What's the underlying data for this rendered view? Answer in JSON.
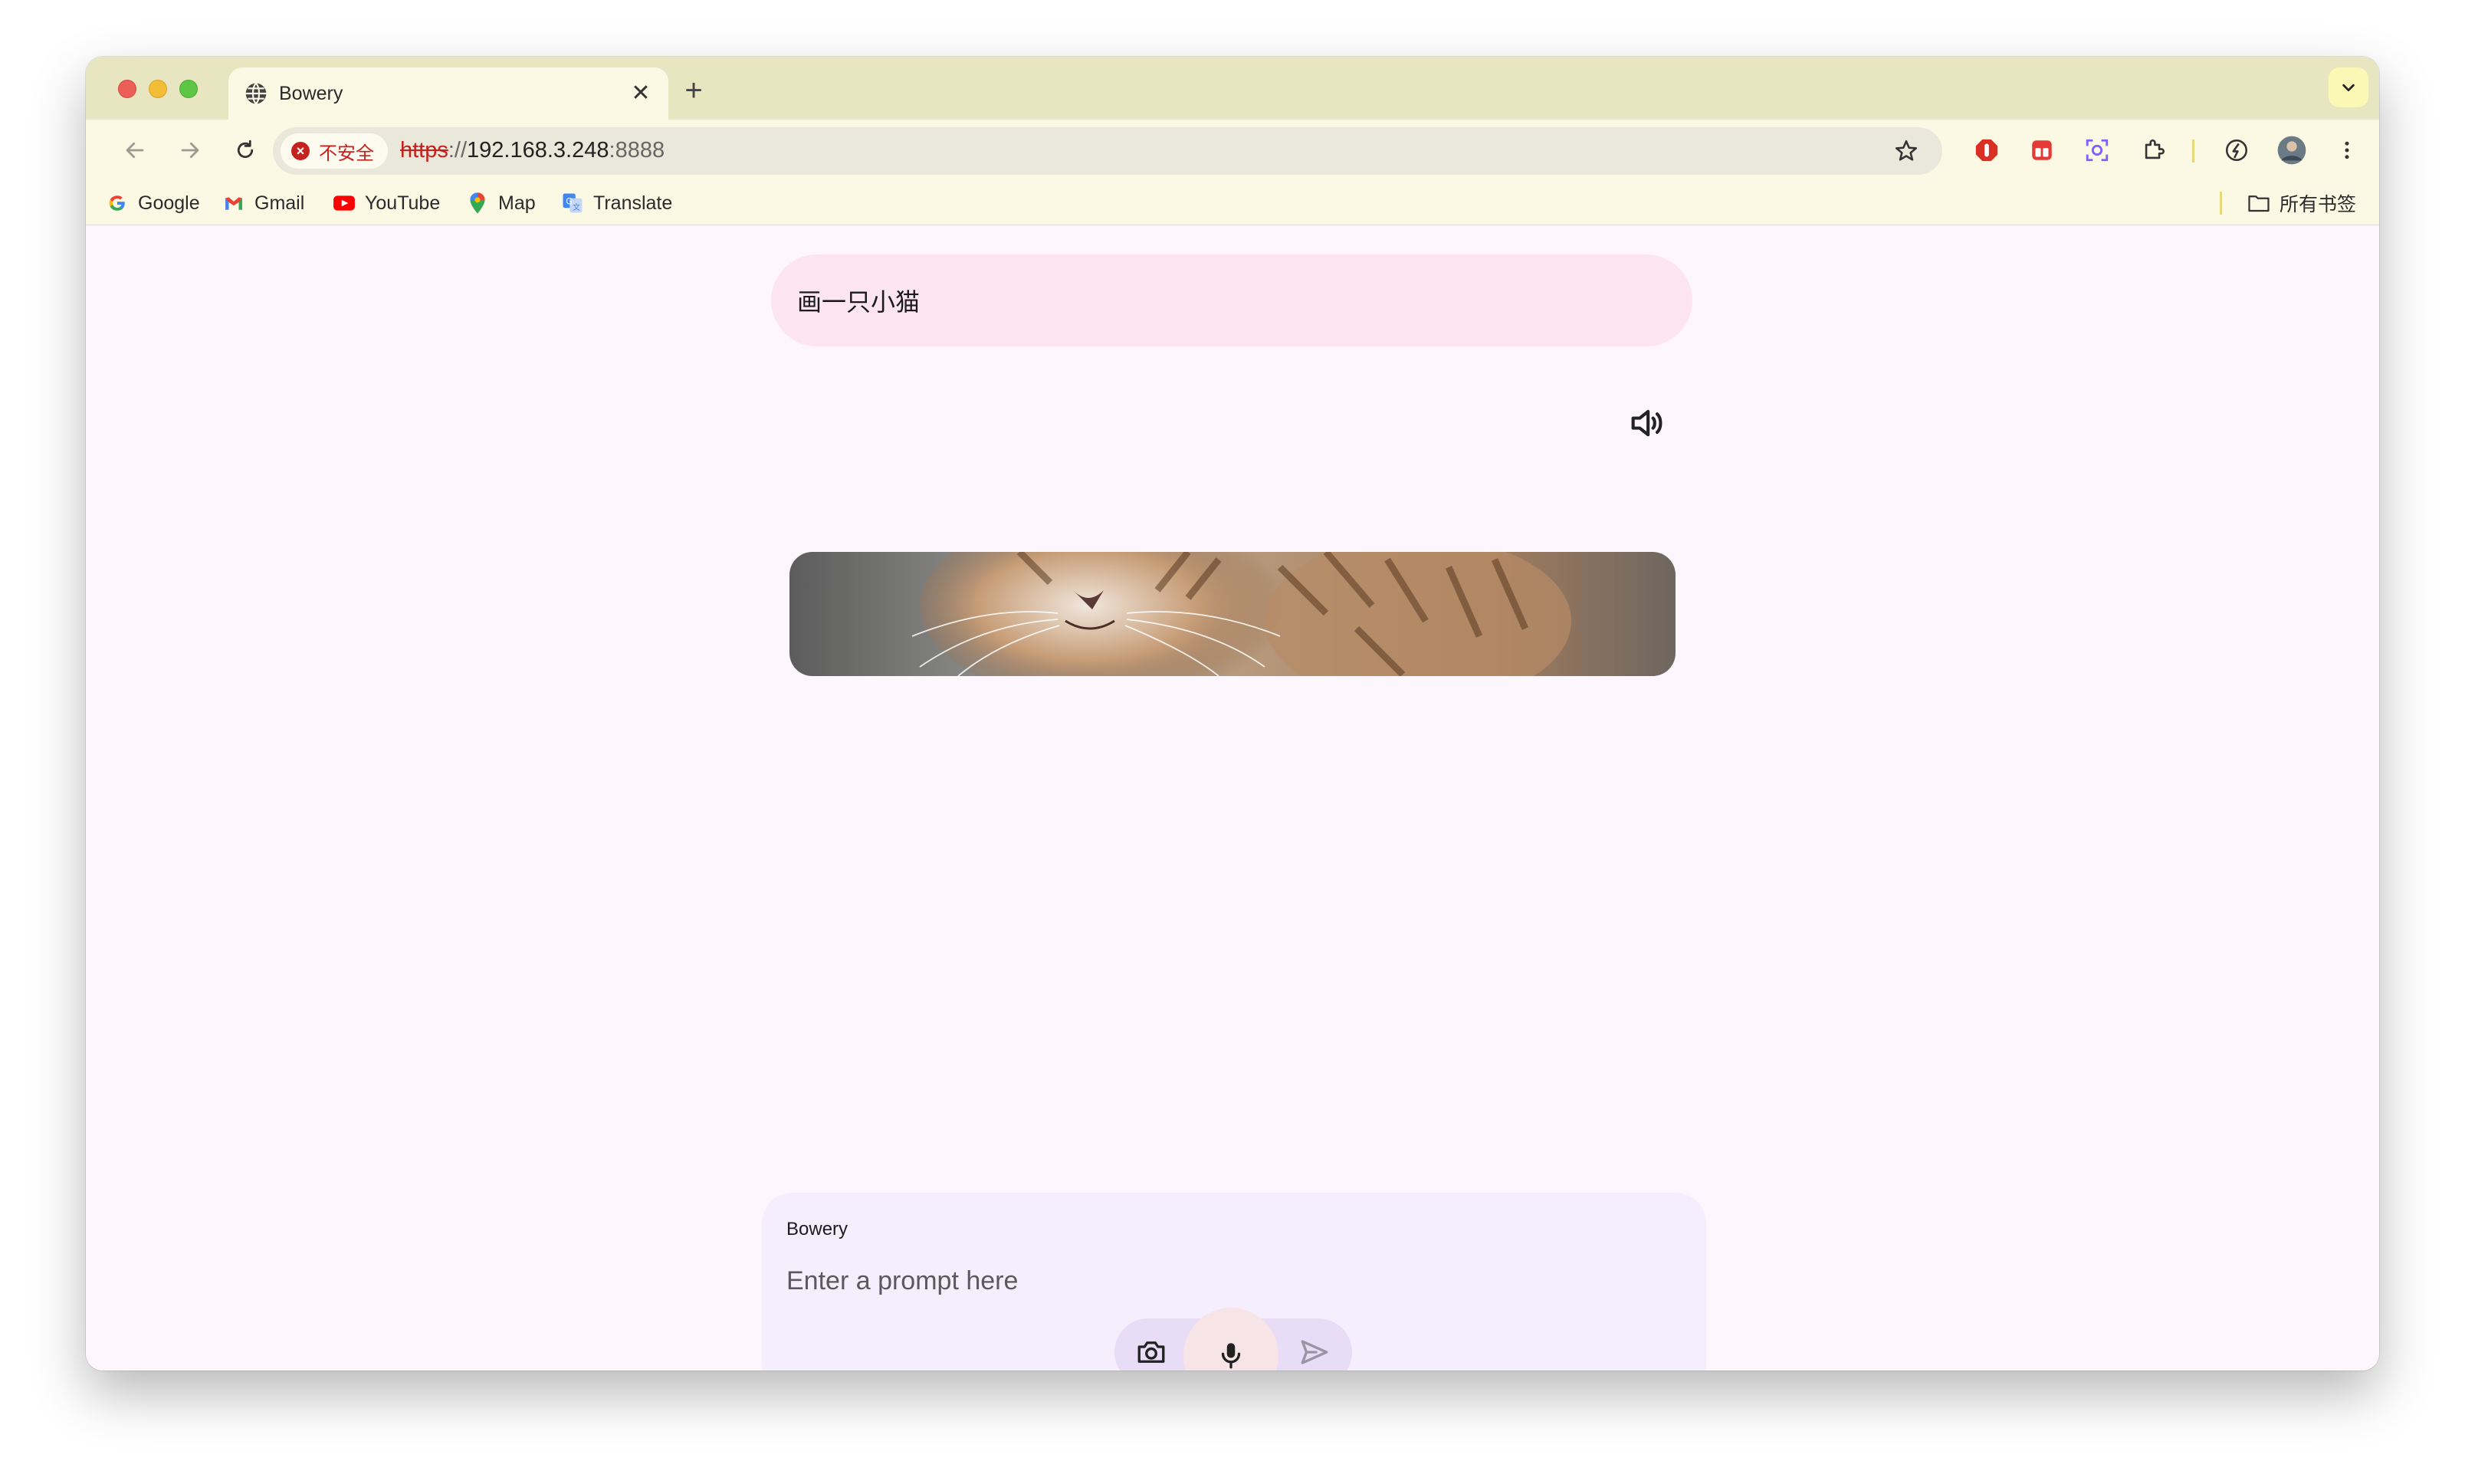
{
  "browser": {
    "tab_title": "Bowery",
    "security_label": "不安全",
    "url_scheme": "https",
    "url_sep": "://",
    "url_host": "192.168.3.248",
    "url_port": ":8888"
  },
  "bookmarks": {
    "items": [
      {
        "label": "Google",
        "icon": "google-icon"
      },
      {
        "label": "Gmail",
        "icon": "gmail-icon"
      },
      {
        "label": "YouTube",
        "icon": "youtube-icon"
      },
      {
        "label": "Map",
        "icon": "map-pin-icon"
      },
      {
        "label": "Translate",
        "icon": "translate-icon"
      }
    ],
    "all_bookmarks_label": "所有书签"
  },
  "chat": {
    "user_message": "画一只小猫",
    "image_alt_icon": "cat-image"
  },
  "prompt": {
    "model_label": "Bowery",
    "placeholder": "Enter a prompt here"
  },
  "colors": {
    "tabstrip": "#e7e6c0",
    "toolbar": "#fbf8e4",
    "page_bg": "#fdf7fd",
    "user_bubble": "#fce5ef",
    "prompt_box": "#f5eefc",
    "danger": "#c5221f"
  }
}
